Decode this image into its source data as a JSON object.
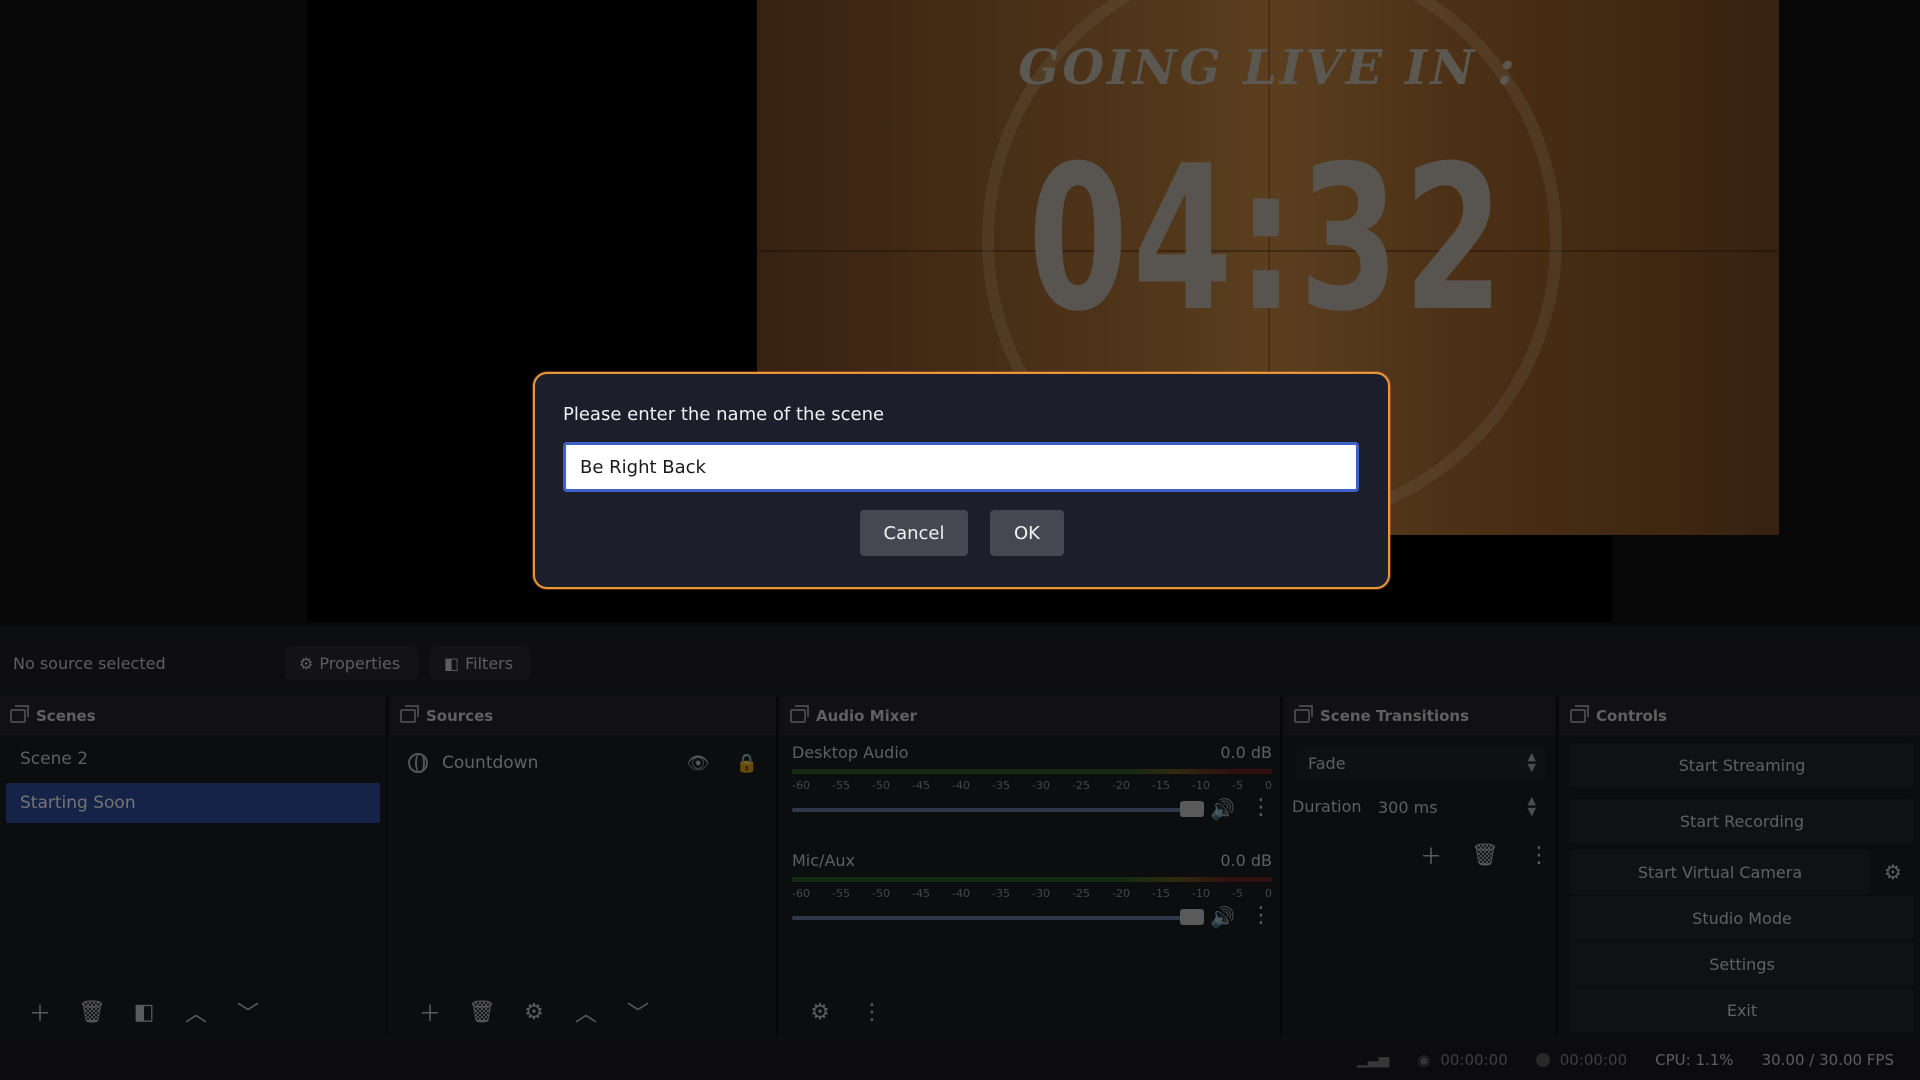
{
  "preview": {
    "going_live_text": "GOING LIVE IN :",
    "countdown": "04:32"
  },
  "source_toolbar": {
    "status": "No source selected",
    "properties_label": "Properties",
    "filters_label": "Filters"
  },
  "scenes": {
    "title": "Scenes",
    "items": [
      "Scene 2",
      "Starting Soon"
    ],
    "selected": "Starting Soon"
  },
  "sources": {
    "title": "Sources",
    "items": [
      {
        "name": "Countdown",
        "type": "browser-source"
      }
    ]
  },
  "audio_mixer": {
    "title": "Audio Mixer",
    "channels": [
      {
        "name": "Desktop Audio",
        "level": "0.0 dB"
      },
      {
        "name": "Mic/Aux",
        "level": "0.0 dB"
      }
    ],
    "ticks": [
      "-60",
      "-55",
      "-50",
      "-45",
      "-40",
      "-35",
      "-30",
      "-25",
      "-20",
      "-15",
      "-10",
      "-5",
      "0"
    ]
  },
  "scene_transitions": {
    "title": "Scene Transitions",
    "transition": "Fade",
    "duration_label": "Duration",
    "duration_value": "300 ms"
  },
  "controls": {
    "title": "Controls",
    "buttons": [
      "Start Streaming",
      "Start Recording",
      "Start Virtual Camera",
      "Studio Mode",
      "Settings",
      "Exit"
    ]
  },
  "status_bar": {
    "stream_time": "00:00:00",
    "record_time": "00:00:00",
    "cpu": "CPU: 1.1%",
    "fps": "30.00 / 30.00 FPS"
  },
  "dialog": {
    "prompt": "Please enter the name of the scene",
    "input_value": "Be Right Back",
    "cancel_label": "Cancel",
    "ok_label": "OK"
  },
  "colors": {
    "dialog_border": "#e8963a",
    "input_focus": "#3f62c9",
    "selected_scene": "#2f4ea2"
  }
}
